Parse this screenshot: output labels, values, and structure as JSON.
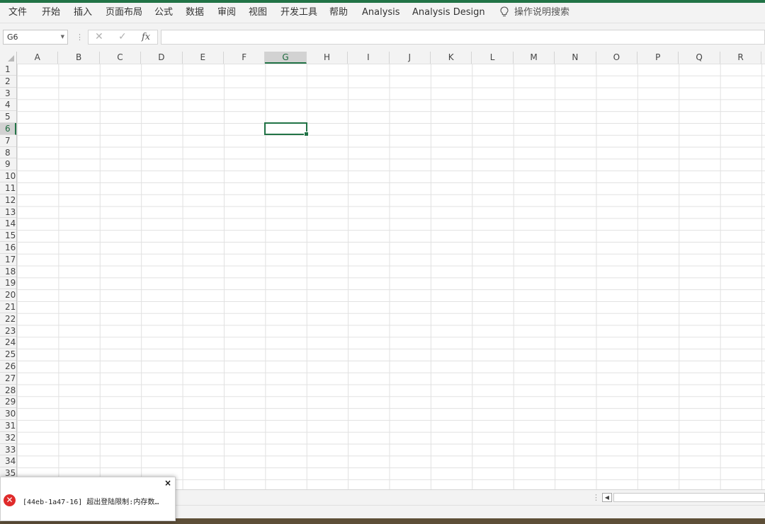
{
  "menu": {
    "items": [
      "文件",
      "开始",
      "插入",
      "页面布局",
      "公式",
      "数据",
      "审阅",
      "视图",
      "开发工具",
      "帮助",
      "Analysis",
      "Analysis Design"
    ],
    "tell_me": "操作说明搜索",
    "tell_me_icon": "lightbulb-icon"
  },
  "formula_bar": {
    "name_box": "G6",
    "cancel_symbol": "✕",
    "enter_symbol": "✓",
    "fx_label": "fx",
    "formula_value": ""
  },
  "sheet": {
    "columns": [
      "A",
      "B",
      "C",
      "D",
      "E",
      "F",
      "G",
      "H",
      "I",
      "J",
      "K",
      "L",
      "M",
      "N",
      "O",
      "P",
      "Q",
      "R"
    ],
    "rows": [
      "1",
      "2",
      "3",
      "4",
      "5",
      "6",
      "7",
      "8",
      "9",
      "10",
      "11",
      "12",
      "13",
      "14",
      "15",
      "16",
      "17",
      "18",
      "19",
      "20",
      "21",
      "22",
      "23",
      "24",
      "25",
      "26",
      "27",
      "28",
      "29",
      "30",
      "31",
      "32",
      "33",
      "34",
      "35"
    ],
    "selected_column": "G",
    "selected_row": "6"
  },
  "toast": {
    "close_label": "×",
    "message": "[44eb-1a47-16] 超出登陆限制:内存数…",
    "icon": "error-icon"
  },
  "colors": {
    "accent": "#217346",
    "error": "#e02b2b"
  }
}
